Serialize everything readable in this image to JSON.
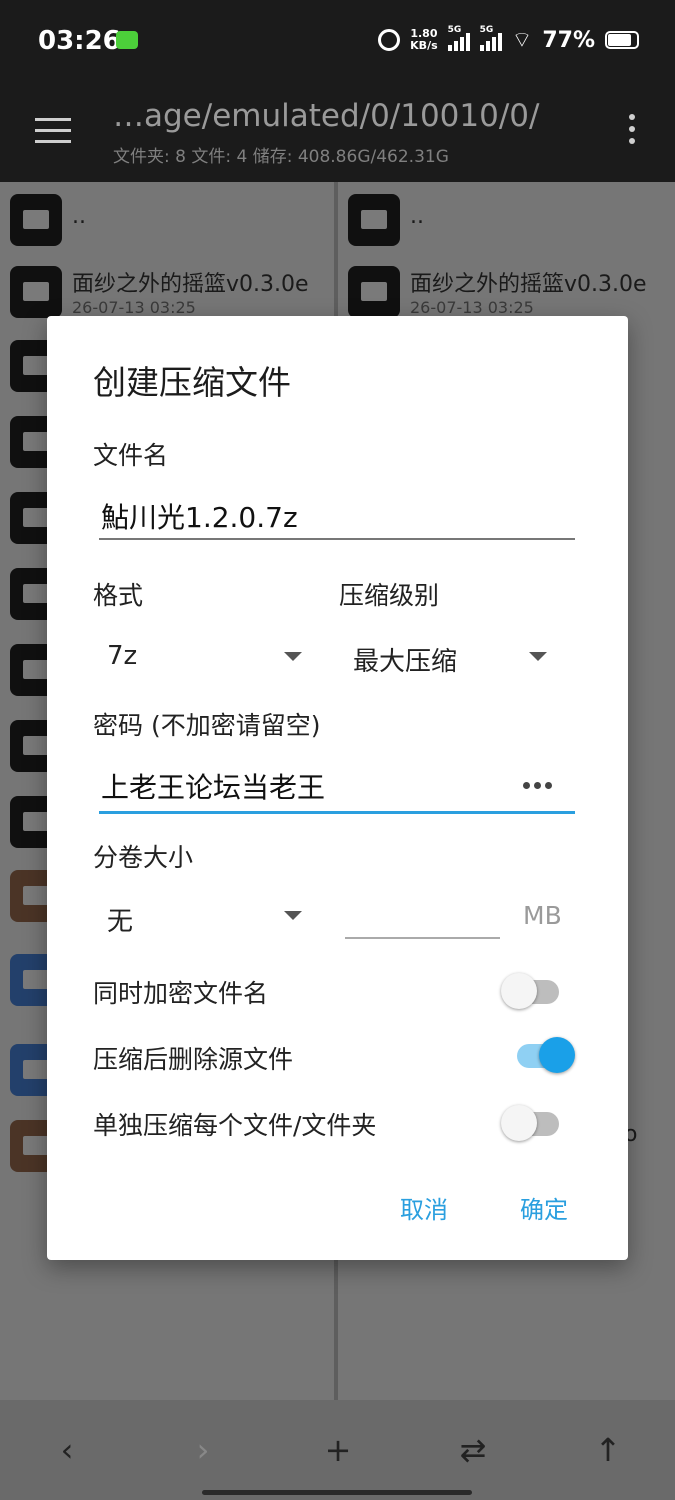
{
  "status_bar": {
    "time": "03:26",
    "speed_value": "1.80",
    "speed_unit": "KB/s",
    "sim1": "5G",
    "sim2": "5G",
    "battery_percent": "77%",
    "battery_level": 0.77,
    "icons": [
      "app-notification-icon",
      "alarm-icon",
      "signal-icon",
      "wifi-icon",
      "battery-icon"
    ]
  },
  "app_bar": {
    "path": "…age/emulated/0/10010/0/",
    "stats": "文件夹: 8  文件: 4  储存: 408.86G/462.31G",
    "icons": [
      "menu-icon",
      "more-vert-icon"
    ]
  },
  "left_pane": {
    "items": [
      {
        "name": "..",
        "date": ""
      },
      {
        "name": "面纱之外的摇篮v0.3.0e",
        "date": "26-07-13 03:25"
      }
    ]
  },
  "right_pane": {
    "items": [
      {
        "name": "..",
        "date": ""
      },
      {
        "name": "面纱之外的摇篮v0.3.0e",
        "date": "26-07-13 03:25"
      }
    ],
    "partial_text": "o"
  },
  "dialog": {
    "title": "创建压缩文件",
    "filename_label": "文件名",
    "filename_value": "鮎川光1.2.0.7z",
    "format_label": "格式",
    "format_value": "7z",
    "level_label": "压缩级别",
    "level_value": "最大压缩",
    "password_label": "密码 (不加密请留空)",
    "password_value": "上老王论坛当老王",
    "split_label": "分卷大小",
    "split_value": "无",
    "split_unit": "MB",
    "toggles": [
      {
        "label": "同时加密文件名",
        "on": false
      },
      {
        "label": "压缩后删除源文件",
        "on": true
      },
      {
        "label": "单独压缩每个文件/文件夹",
        "on": false
      }
    ],
    "cancel": "取消",
    "ok": "确定",
    "accent_color": "#2a9fdf"
  },
  "bottom_bar": {
    "icons": [
      "back-icon",
      "forward-icon",
      "add-icon",
      "swap-icon",
      "up-icon"
    ],
    "glyphs": [
      "‹",
      "›",
      "+",
      "⇄",
      "↑"
    ]
  }
}
